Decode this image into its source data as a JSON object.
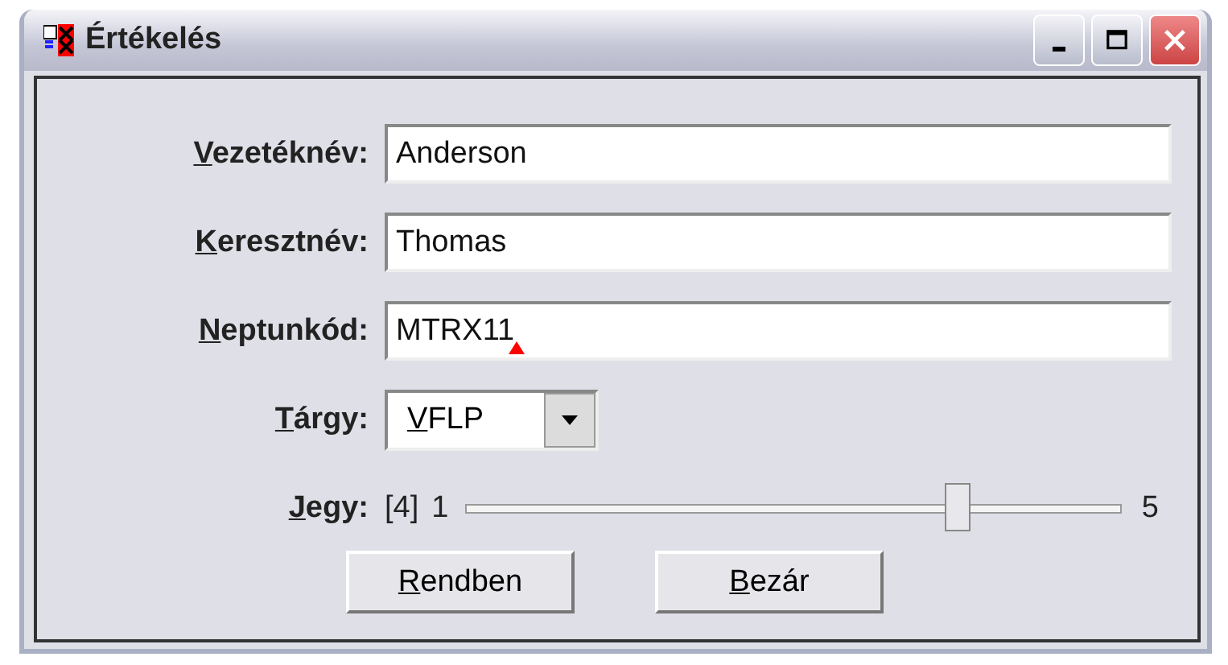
{
  "window": {
    "title": "Értékelés"
  },
  "fields": [
    {
      "label": "Vezetéknév:",
      "value": "Anderson",
      "marker": false
    },
    {
      "label": "Keresztnév:",
      "value": "Thomas",
      "marker": false
    },
    {
      "label": "Neptunkód:",
      "value": "MTRX11",
      "marker": true
    }
  ],
  "subject": {
    "label": "Tárgy:",
    "value": "VFLP"
  },
  "grade": {
    "label": "Jegy:",
    "reading": "[4]",
    "min": "1",
    "max": "5",
    "level": 0.75
  },
  "buttons": [
    "Rendben",
    "Bezár"
  ]
}
